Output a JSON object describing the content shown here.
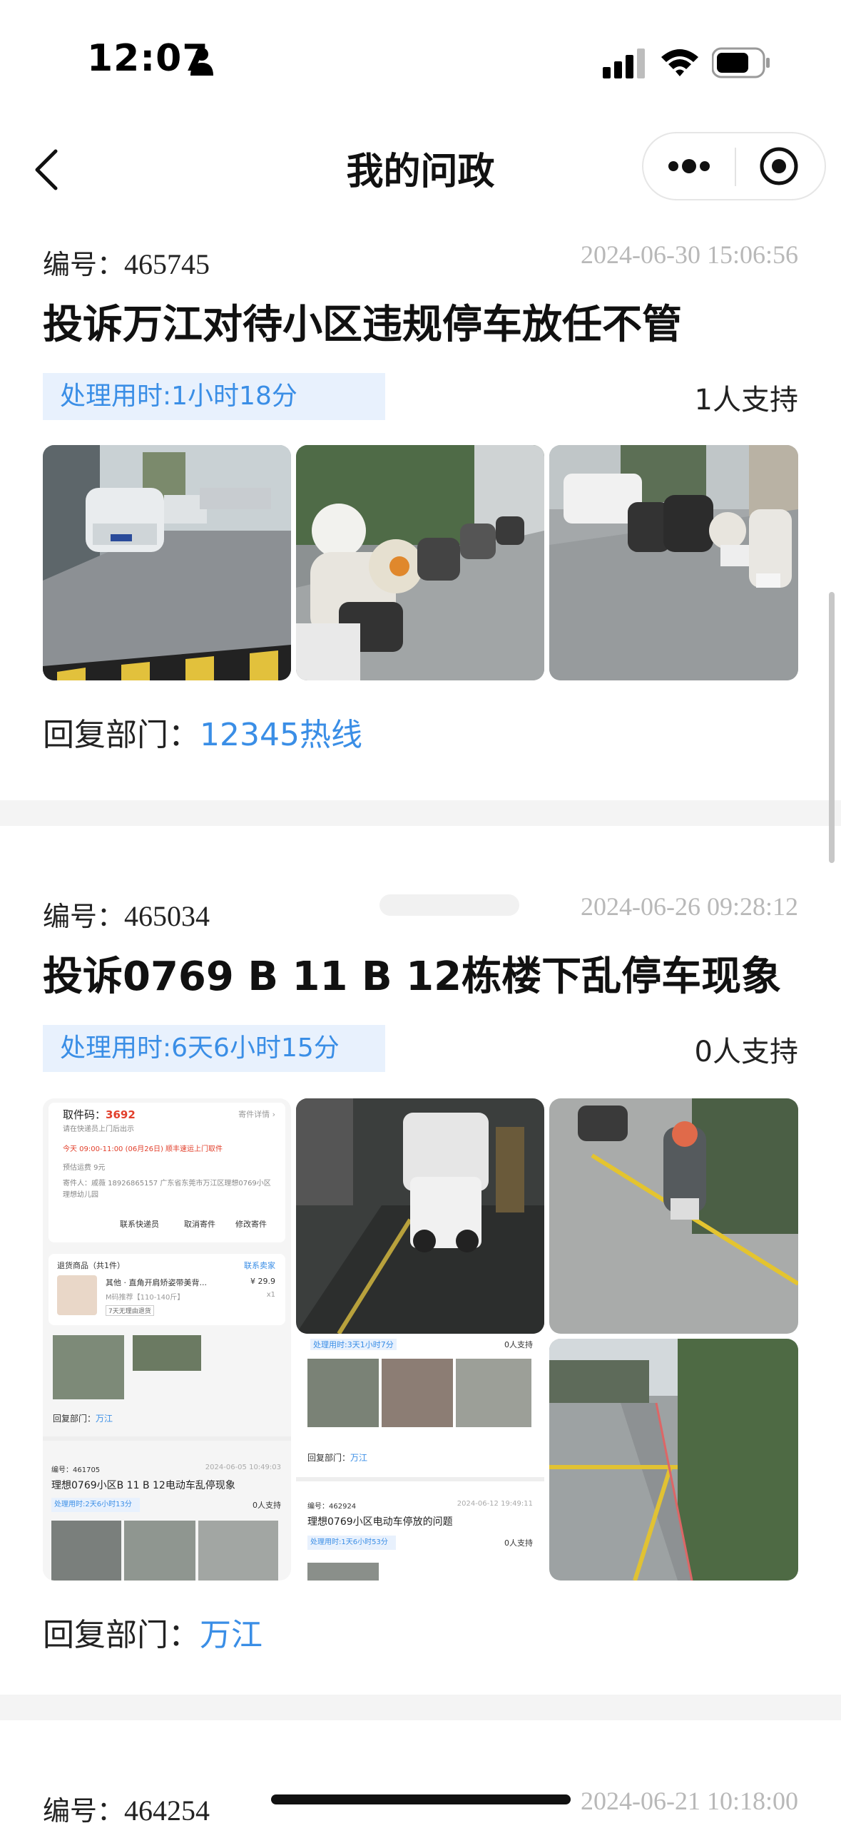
{
  "status_bar": {
    "time": "12:07",
    "icons": [
      "person-icon",
      "signal-icon",
      "wifi-icon",
      "battery-icon"
    ]
  },
  "nav": {
    "title": "我的问政",
    "icons": [
      "back-icon",
      "more-dots-icon",
      "target-icon"
    ]
  },
  "cards": [
    {
      "id_label": "编号：",
      "id": "465745",
      "date": "2024-06-30 15:06:56",
      "title": "投诉万江对待小区违规停车放任不管",
      "time_badge": "处理用时:1小时18分",
      "support": "1人支持",
      "reply_label": "回复部门：",
      "reply_dept": "12345热线"
    },
    {
      "id_label": "编号：",
      "id": "465034",
      "date": "2024-06-26 09:28:12",
      "title": "投诉0769 B 11 B 12栋楼下乱停车现象",
      "time_badge": "处理用时:6天6小时15分",
      "support": "0人支持",
      "reply_label": "回复部门：",
      "reply_dept": "万江",
      "screenshot_text": {
        "pickup_code_label": "取件码：",
        "pickup_code": "3692",
        "order_detail": "寄件详情 ›",
        "courier_note": "请在快递员上门后出示",
        "pickup_time": "今天 09:00-11:00 (06月26日) 顺丰速运上门取件",
        "fee": "预估运费 9元",
        "sender": "寄件人：戚薇 18926865157 广东省东莞市万江区理想0769小区理想幼儿园",
        "action_contact": "联系快递员",
        "action_cancel": "取消寄件",
        "action_modify": "修改寄件",
        "return_goods": "退货商品（共1件）",
        "contact_seller": "联系卖家",
        "product": "其他 · 直角开肩矫姿带美背...",
        "price": "¥ 29.9",
        "product_spec": "M码推荐【110-140斤】",
        "qty": "x1",
        "return_note": "7天无理由退货",
        "reply_dept_label": "回复部门：",
        "reply_dept_small": "万江",
        "sub_id_1": "编号：461705",
        "sub_date_1": "2024-06-05 10:49:03",
        "sub_title_1": "理想0769小区B 11 B 12电动车乱停现象",
        "sub_time_1": "处理用时:2天6小时13分",
        "sub_support_1": "0人支持",
        "mid_time": "处理用时:3天1小时7分",
        "mid_support": "0人支持",
        "mid_reply_label": "回复部门：",
        "mid_reply_dept": "万江",
        "sub_id_2": "编号：462924",
        "sub_date_2": "2024-06-12 19:49:11",
        "sub_title_2": "理想0769小区电动车停放的问题",
        "sub_time_2": "处理用时:1天6小时53分",
        "sub_support_2": "0人支持"
      }
    },
    {
      "id_label": "编号：",
      "id": "464254",
      "date": "2024-06-21 10:18:00"
    }
  ]
}
